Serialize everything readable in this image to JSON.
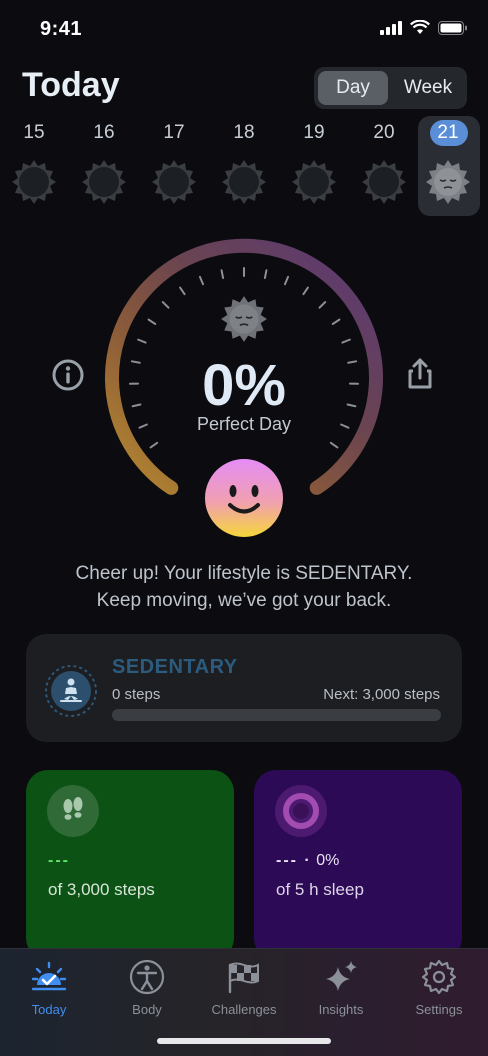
{
  "status": {
    "time": "9:41"
  },
  "header": {
    "title": "Today"
  },
  "segment": {
    "day": "Day",
    "week": "Week"
  },
  "days": [
    "15",
    "16",
    "17",
    "18",
    "19",
    "20",
    "21"
  ],
  "selected_day": "21",
  "dial": {
    "percent": "0%",
    "label": "Perfect Day"
  },
  "message": {
    "line1": "Cheer up! Your lifestyle is SEDENTARY.",
    "line2": "Keep moving, we’ve got your back."
  },
  "level": {
    "name": "SEDENTARY",
    "steps": "0 steps",
    "next": "Next: 3,000 steps",
    "progress": 0
  },
  "tiles": {
    "steps": {
      "value": "---",
      "label": "of 3,000 steps"
    },
    "sleep": {
      "value": "--- ·",
      "percent": "0%",
      "label": "of 5 h sleep"
    }
  },
  "tabs": [
    {
      "label": "Today",
      "icon": "sunrise-check-icon"
    },
    {
      "label": "Body",
      "icon": "body-figure-icon"
    },
    {
      "label": "Challenges",
      "icon": "checkered-flag-icon"
    },
    {
      "label": "Insights",
      "icon": "sparkles-icon"
    },
    {
      "label": "Settings",
      "icon": "gear-icon"
    }
  ],
  "colors": {
    "accent": "#3f8ef0",
    "steps_tile": "#0b5214",
    "sleep_tile": "#2d0a55",
    "steps_value": "#5fe46a"
  }
}
